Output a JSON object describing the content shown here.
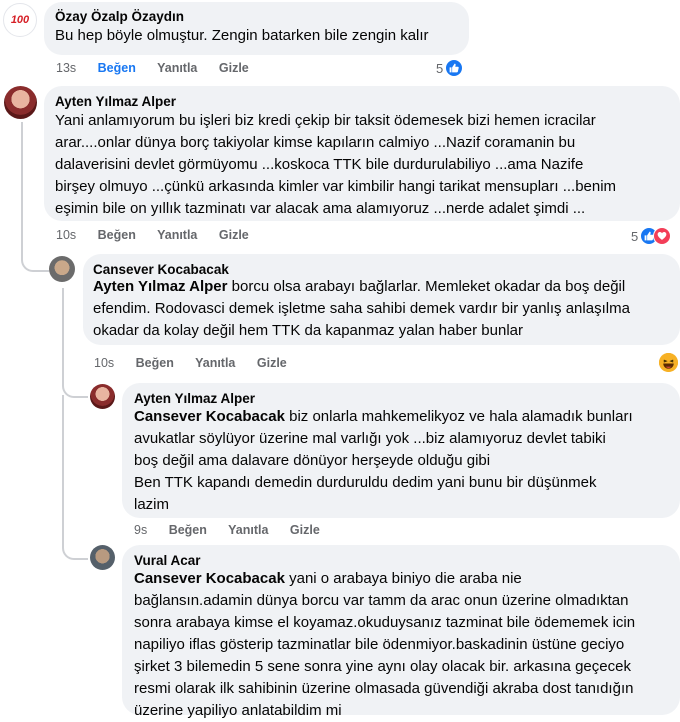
{
  "comments": [
    {
      "author": "Özay Özalp Özaydın",
      "text": "Bu hep böyle olmuştur. Zengin batarken bile zengin kalır",
      "time": "13s",
      "like_label": "Beğen",
      "reply_label": "Yanıtla",
      "hide_label": "Gizle",
      "reaction_count": "5",
      "avatar_text": "100"
    },
    {
      "author": "Ayten Yılmaz Alper",
      "lines": [
        "Yani anlamıyorum bu işleri biz kredi çekip bir taksit ödemesek bizi hemen icracilar",
        "arar....onlar dünya borç takiyolar kimse kapıların calmiyo ...Nazif coramanin bu",
        "dalaverisini devlet görmüyomu ...koskoca TTK bile durdurulabiliyo ...ama Nazife",
        "birşey olmuyo ...çünkü arkasında kimler var kimbilir hangi tarikat mensupları ...benim",
        "eşimin bile on yıllık tazminatı var alacak ama alamıyoruz ...nerde adalet şimdi ..."
      ],
      "time": "10s",
      "like_label": "Beğen",
      "reply_label": "Yanıtla",
      "hide_label": "Gizle",
      "reaction_count": "5"
    },
    {
      "author": "Cansever Kocabacak",
      "mention": "Ayten Yılmaz Alper",
      "line1_rest": " borcu olsa arabayı bağlarlar. Memleket okadar da boş değil",
      "lines": [
        "efendim. Rodovasci demek işletme saha sahibi demek vardır bir yanlış anlaşılma",
        "okadar da kolay değil hem TTK da kapanmaz yalan haber bunlar"
      ],
      "time": "10s",
      "like_label": "Beğen",
      "reply_label": "Yanıtla",
      "hide_label": "Gizle"
    },
    {
      "author": "Ayten Yılmaz Alper",
      "mention": "Cansever Kocabacak",
      "line1_rest": " biz onlarla mahkemelikyoz ve hala alamadık bunları",
      "lines": [
        "avukatlar söylüyor üzerine mal varlığı yok ...biz alamıyoruz devlet tabiki",
        "boş değil ama dalavare dönüyor herşeyde olduğu gibi",
        "Ben TTK kapandı demedin durduruldu dedim yani bunu bir düşünmek",
        "lazim"
      ],
      "time": "9s",
      "like_label": "Beğen",
      "reply_label": "Yanıtla",
      "hide_label": "Gizle"
    },
    {
      "author": "Vural Acar",
      "mention": "Cansever Kocabacak",
      "line1_rest": " yani o arabaya biniyo die araba nie",
      "lines": [
        "bağlansın.adamin dünya borcu var tamm da arac onun üzerine olmadıktan",
        "sonra arabaya kimse el koyamaz.okuduysanız tazminat bile ödememek icin",
        "napiliyo iflas gösterip tazminatlar bile ödenmiyor.baskadinin üstüne geciyo",
        "şirket 3 bilemedin 5 sene sonra yine aynı olay olacak bir. arkasına geçecek",
        "resmi olarak ilk sahibinin üzerine olmasada güvendiği akraba dost tanıdığın",
        "üzerine yapiliyo anlatabildim mi"
      ]
    }
  ],
  "icons": {
    "like": "like-icon",
    "love": "love-icon",
    "haha": "haha-icon"
  },
  "colors": {
    "bubble": "#f0f2f5",
    "accent": "#1877f2",
    "meta": "#65676b"
  }
}
